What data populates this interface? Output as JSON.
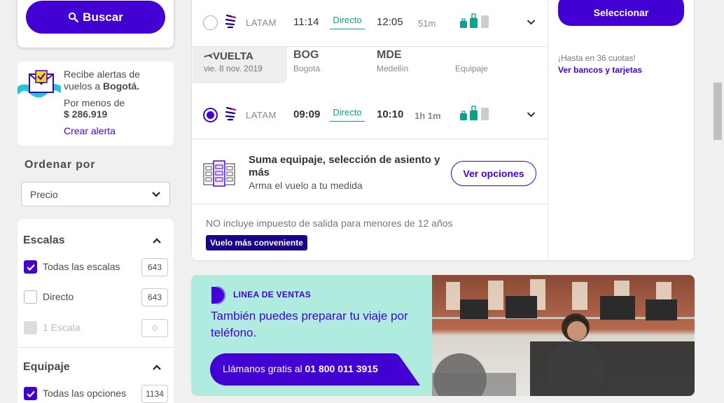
{
  "search": {
    "label": "Buscar"
  },
  "alert": {
    "line1": "Recibe alertas de vuelos a ",
    "city": "Bogotá.",
    "price_label": "Por menos de",
    "price": "$ 286.919",
    "link": "Crear alerta"
  },
  "sort": {
    "label": "Ordenar por",
    "value": "Precio"
  },
  "filters": {
    "stops": {
      "title": "Escalas",
      "options": [
        {
          "label": "Todas las escalas",
          "count": "643",
          "checked": true
        },
        {
          "label": "Directo",
          "count": "643",
          "checked": false
        },
        {
          "label": "1 Escala",
          "count": "0",
          "disabled": true
        }
      ]
    },
    "luggage": {
      "title": "Equipaje",
      "options": [
        {
          "label": "Todas las opciones",
          "count": "1134",
          "checked": true
        }
      ]
    }
  },
  "outbound": {
    "airline": "LATAM",
    "depart": "11:14",
    "stops": "Directo",
    "arrive": "12:05",
    "duration": "51m"
  },
  "return_leg": {
    "title": "VUELTA",
    "date": "vie. 8 nov. 2019",
    "from_code": "BOG",
    "from_city": "Bogotá",
    "to_code": "MDE",
    "to_city": "Medellín",
    "luggage_label": "Equipaje",
    "airline": "LATAM",
    "depart": "09:09",
    "stops": "Directo",
    "arrive": "10:10",
    "duration": "1h 1m"
  },
  "upsell": {
    "title": "Suma equipaje, selección de asiento y más",
    "subtitle": "Arma el vuelo a tu medida",
    "button": "Ver opciones"
  },
  "tax_note": "NO incluye impuesto de salida para menores de 12 años",
  "badge": "Vuelo más conveniente",
  "pricing": {
    "select_button": "Seleccionar",
    "installments": "¡Hasta en 36 cuotas!",
    "banks_link": "Ver bancos y tarjetas"
  },
  "promo": {
    "kicker": "LINEA DE VENTAS",
    "text": "También puedes preparar tu viaje por teléfono.",
    "cta_prefix": "Llámanos gratis al ",
    "cta_phone": "01 800 011 3915"
  },
  "colors": {
    "brand": "#4300d2",
    "accent": "#0da190",
    "promo_bg": "#b0ebe0",
    "badge": "#1b0088"
  }
}
